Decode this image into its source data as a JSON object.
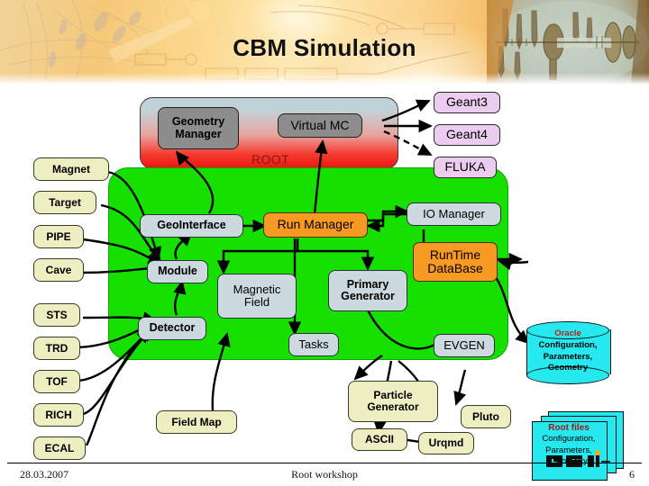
{
  "slide": {
    "title": "CBM Simulation",
    "footer": {
      "date": "28.03.2007",
      "center": "Root workshop",
      "page": "6",
      "logo": "GSI"
    }
  },
  "root_panel": {
    "label": "ROOT",
    "boxes": [
      {
        "id": "geometry-manager",
        "label": "Geometry\nManager",
        "label_line1": "Geometry",
        "label_line2": "Manager"
      },
      {
        "id": "virtual-mc",
        "label": "Virtual MC"
      }
    ]
  },
  "backends": [
    {
      "id": "geant3",
      "label": "Geant3",
      "link": "solid"
    },
    {
      "id": "geant4",
      "label": "Geant4",
      "link": "solid"
    },
    {
      "id": "fluka",
      "label": "FLUKA",
      "link": "dashed"
    }
  ],
  "detectors": [
    {
      "id": "magnet",
      "label": "Magnet"
    },
    {
      "id": "target",
      "label": "Target"
    },
    {
      "id": "pipe",
      "label": "PIPE"
    },
    {
      "id": "cave",
      "label": "Cave"
    },
    {
      "id": "sts",
      "label": "STS"
    },
    {
      "id": "trd",
      "label": "TRD"
    },
    {
      "id": "tof",
      "label": "TOF"
    },
    {
      "id": "rich",
      "label": "RICH"
    },
    {
      "id": "ecal",
      "label": "ECAL"
    }
  ],
  "framework": {
    "geo_interface": "GeoInterface",
    "module": "Module",
    "detector": "Detector",
    "run_manager": "Run Manager",
    "magnetic_field_line1": "Magnetic",
    "magnetic_field_line2": "Field",
    "tasks": "Tasks",
    "primary_generator_line1": "Primary",
    "primary_generator_line2": "Generator",
    "io_manager": "IO Manager",
    "runtime_db_line1": "RunTime",
    "runtime_db_line2": "DataBase",
    "evgen": "EVGEN"
  },
  "external": {
    "field_map": "Field Map",
    "particle_generator_line1": "Particle",
    "particle_generator_line2": "Generator",
    "ascii": "ASCII",
    "urqmd": "Urqmd",
    "pluto": "Pluto"
  },
  "storage": {
    "oracle": {
      "header": "Oracle",
      "line1": "Configuration,",
      "line2": "Parameters,",
      "line3": "Geometry"
    },
    "root_files": {
      "header": "Root files",
      "line1": "Configuration,",
      "line2": "Parameters,",
      "line3": "Geometry"
    }
  },
  "colors": {
    "green_panel": "#16e000",
    "orange_box": "#f79a23",
    "blue_box": "#ccd9de",
    "yellow_box": "#edefc3",
    "lavender_box": "#edcdef",
    "cyan_storage": "#25e9ee",
    "root_gradient_top": "#bdd2da",
    "root_gradient_bottom": "#ef1410",
    "gray_box": "#8d8d8d",
    "banner_amber": "#f6c878"
  }
}
